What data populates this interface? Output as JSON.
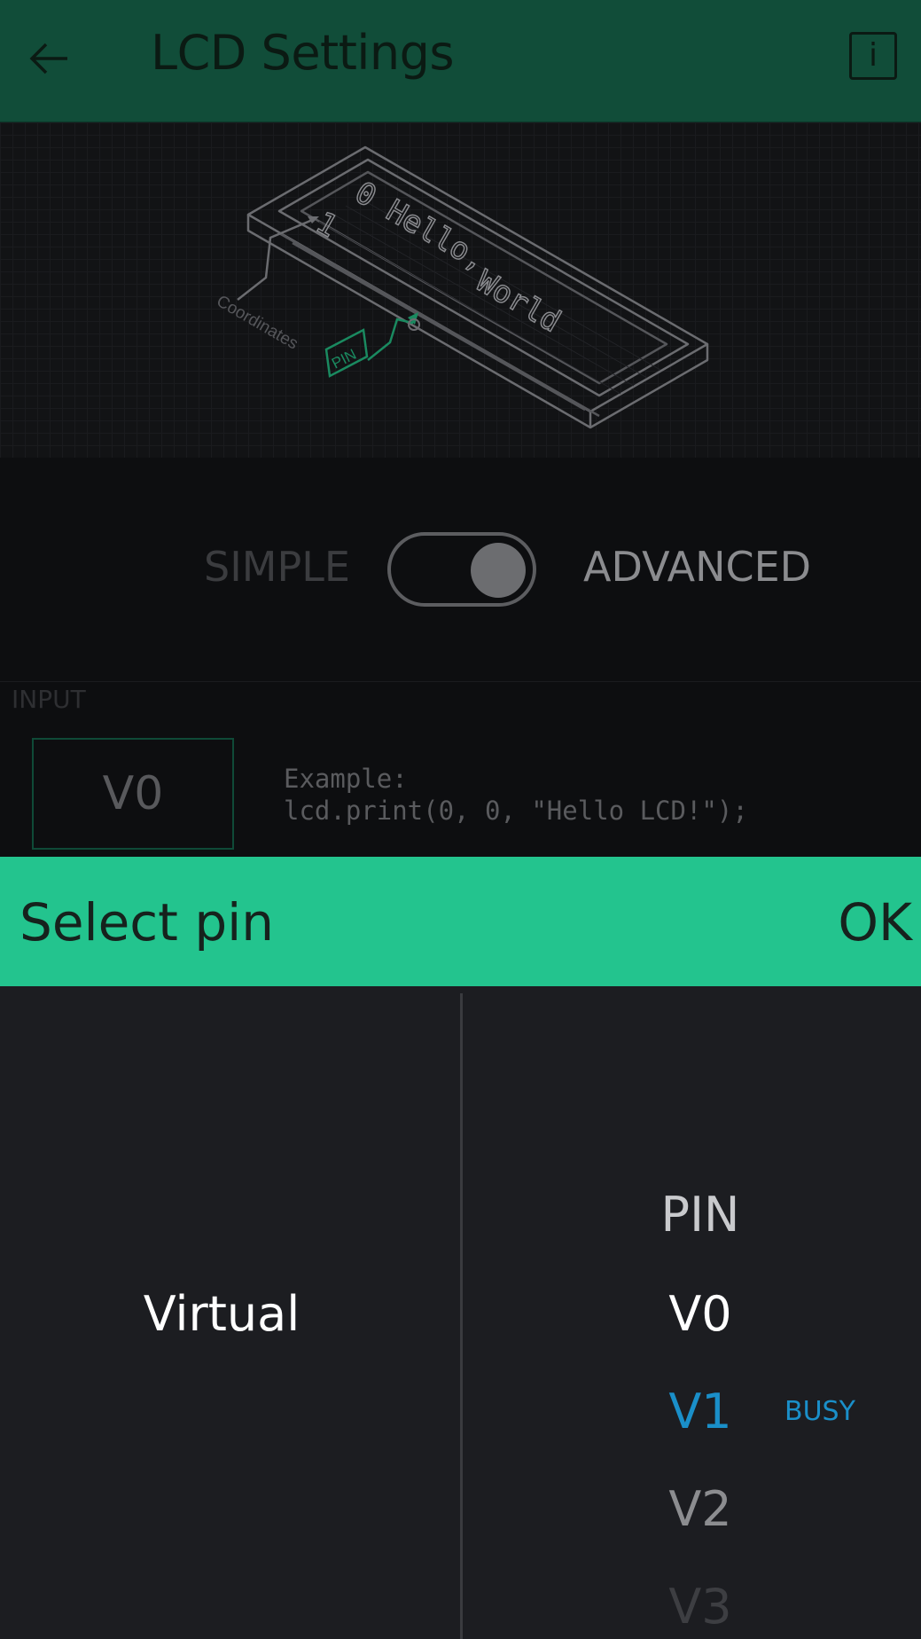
{
  "appbar": {
    "title": "LCD Settings",
    "info_label": "i"
  },
  "illustration": {
    "line1": "0 Hello,",
    "line2": "World",
    "row_label": "1",
    "coordinates_label": "Coordinates",
    "pin_label": "PIN"
  },
  "mode": {
    "simple_label": "SIMPLE",
    "advanced_label": "ADVANCED",
    "selected": "ADVANCED"
  },
  "input": {
    "section_label": "INPUT",
    "pin_value": "V0",
    "example_line1": "Example:",
    "example_line2": "lcd.print(0, 0, \"Hello LCD!\");"
  },
  "dialog": {
    "title": "Select pin",
    "ok_label": "OK",
    "port_options": [
      "Virtual"
    ],
    "pin_options": [
      {
        "label": "PIN",
        "state": "header"
      },
      {
        "label": "V0",
        "state": "selected"
      },
      {
        "label": "V1",
        "state": "busy",
        "badge": "BUSY"
      },
      {
        "label": "V2",
        "state": "normal"
      },
      {
        "label": "V3",
        "state": "faded"
      }
    ]
  },
  "colors": {
    "appbar": "#114d39",
    "accent": "#23c48e",
    "busy": "#1a8fc9",
    "background": "#0d0e10",
    "picker": "#1c1d21"
  }
}
